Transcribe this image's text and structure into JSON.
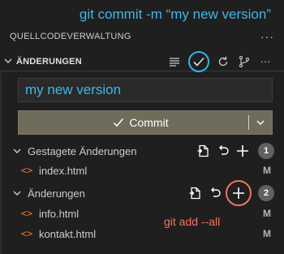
{
  "annotations": {
    "top": "git commit -m “my new version”",
    "bottom": "git add --all"
  },
  "panel": {
    "title": "QUELLCODEVERWALTUNG",
    "more": "···"
  },
  "section": {
    "title": "ÄNDERUNGEN",
    "more": "···"
  },
  "commit_message": {
    "value": "my new version"
  },
  "commit_button": {
    "label": "Commit"
  },
  "groups": [
    {
      "label": "Gestagete Änderungen",
      "count": "1",
      "files": [
        {
          "name": "index.html",
          "status": "M"
        }
      ]
    },
    {
      "label": "Änderungen",
      "count": "2",
      "files": [
        {
          "name": "info.html",
          "status": "M"
        },
        {
          "name": "kontakt.html",
          "status": "M"
        }
      ]
    }
  ],
  "file_icon": "<>",
  "colors": {
    "accent_blue": "#3fb7e8",
    "accent_red": "#f47361",
    "html_icon": "#e37933",
    "commit_button_bg": "#6f6c5c"
  }
}
